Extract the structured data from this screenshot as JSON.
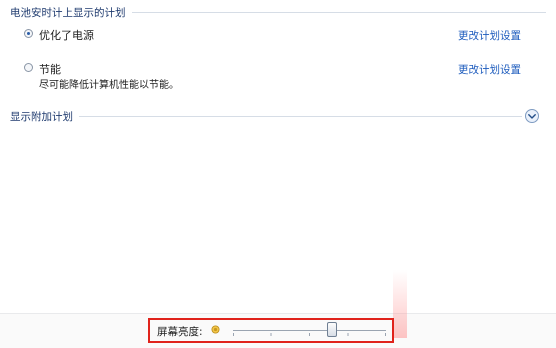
{
  "battery_plans": {
    "header": "电池安时计上显示的计划",
    "plans": [
      {
        "label": "优化了电源",
        "selected": true,
        "description": "",
        "change_link": "更改计划设置"
      },
      {
        "label": "节能",
        "selected": false,
        "description": "尽可能降低计算机性能以节能。",
        "change_link": "更改计划设置"
      }
    ]
  },
  "additional_plans": {
    "header": "显示附加计划",
    "expand_icon": "chevron-down-icon"
  },
  "bottom_bar": {
    "brightness_label": "屏幕亮度:",
    "brightness_icon": "sun-icon",
    "brightness_level": 0.65,
    "highlight_color": "#e0231c"
  },
  "colors": {
    "accent": "#1c5bbd",
    "header_text": "#1e3a6e"
  }
}
